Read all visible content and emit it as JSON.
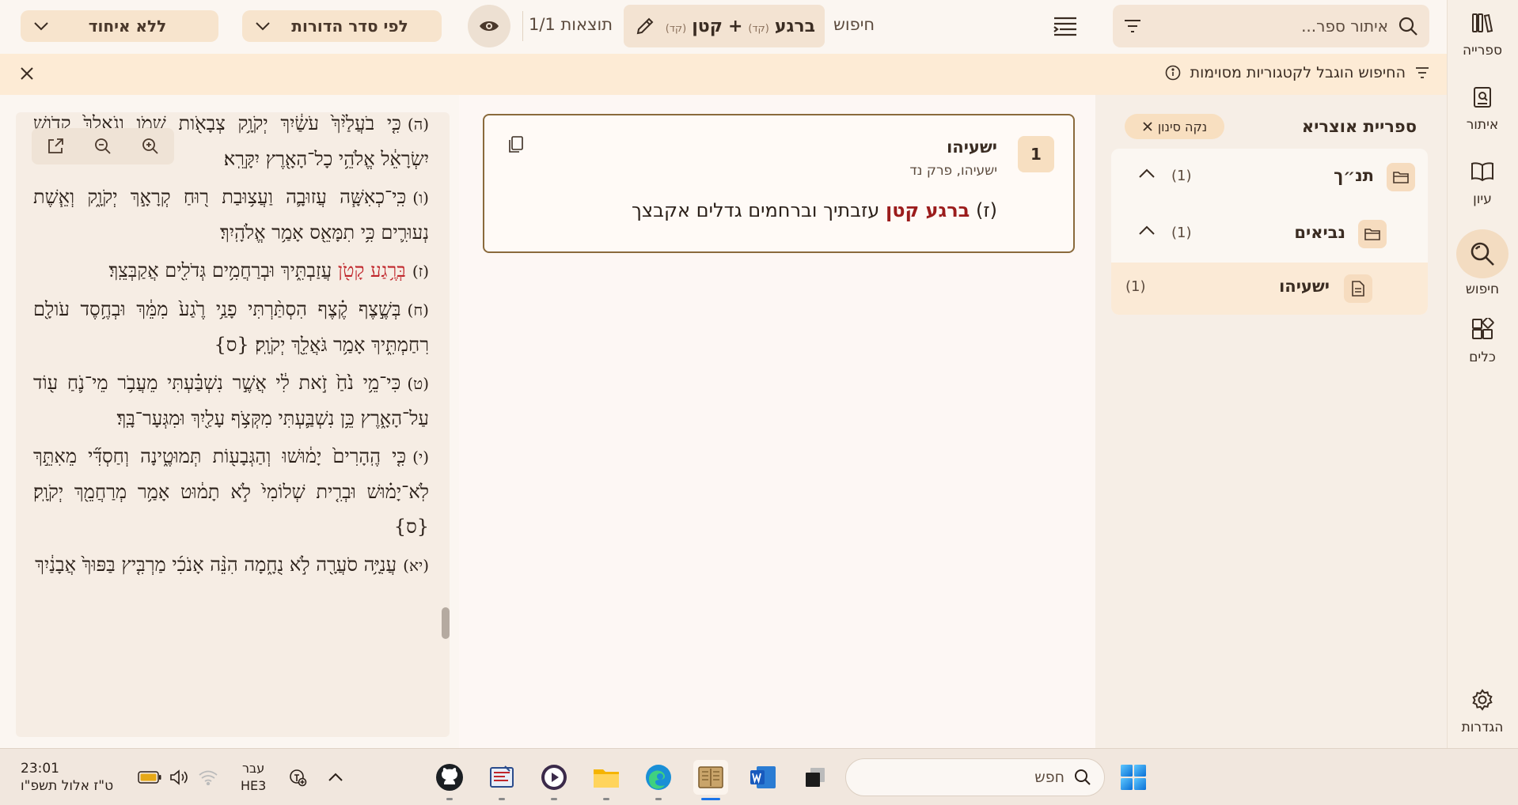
{
  "rail": {
    "items": [
      {
        "label": "ספרייה",
        "icon": "library-icon"
      },
      {
        "label": "איתור",
        "icon": "locate-icon"
      },
      {
        "label": "עיון",
        "icon": "book-open-icon"
      },
      {
        "label": "חיפוש",
        "icon": "search-icon"
      },
      {
        "label": "כלים",
        "icon": "tools-icon"
      },
      {
        "label": "הגדרות",
        "icon": "gear-icon"
      }
    ],
    "active": "חיפוש"
  },
  "topbar": {
    "search_placeholder": "איתור ספר...",
    "tab_label": "חיפוש",
    "query_chip": {
      "term1": "ברגע",
      "term2": "קטן",
      "tag": "(קד)",
      "plus": "+"
    },
    "results_count": "1/1 תוצאות",
    "sort_dropdown": "לפי סדר הדורות",
    "group_dropdown": "ללא איחוד"
  },
  "notice": {
    "text": "החיפוש הוגבל לקטגוריות מסוימות"
  },
  "categories": {
    "title": "ספריית אוצריא",
    "clear_filter": "נקה סינון",
    "tree": [
      {
        "name": "תנ״ך",
        "count": "(1)",
        "type": "folder"
      },
      {
        "name": "נביאים",
        "count": "(1)",
        "type": "folder"
      },
      {
        "name": "ישעיהו",
        "count": "(1)",
        "type": "book"
      }
    ]
  },
  "result": {
    "number": "1",
    "title": "ישעיהו",
    "subtitle": "ישעיהו, פרק נד",
    "prefix": "(ז)",
    "highlight": "ברגע קטן",
    "rest": "עזבתיך וברחמים גדלים אקבצך"
  },
  "preview": {
    "verses": [
      {
        "n": "(ה)",
        "text": "כִּ֤י בֹעֲלַ֙יִךְ֙ עֹשַׂ֔יִךְ יְקֹוָ֥ק צְבָאֹ֖ות שְׁמֹ֑ו וְגֹאֲלֵךְ֙ קְדֹ֣ושׁ יִשְׂרָאֵ֔ל אֱלֹהֵ֥י כָל־הָאָ֖רֶץ יִקָּרֵֽא׃"
      },
      {
        "n": "(ו)",
        "text": "כִּֽי־כְאִשָּׁ֧ה עֲזוּבָ֛ה וַעֲצ֥וּבַת ר֖וּחַ קְרָאָ֣ךְ יְקֹוָ֑ק וְאֵ֧שֶׁת נְעוּרִ֛ים כִּ֥י תִמָּאֵ֖ס אָמַ֥ר אֱלֹהָֽיִךְ׃"
      },
      {
        "n": "(ז)",
        "hl": "בְּרֶ֥גַע קָטֹ֖ן",
        "text": "עֲזַבְתִּ֑יךְ וּבְרַחֲמִ֥ים גְּדֹלִ֖ים אֲקַבְּצֵֽךְ׃"
      },
      {
        "n": "(ח)",
        "text": "בְּשֶׁ֣צֶף קֶ֗צֶף הִסְתַּ֨רְתִּי פָנַ֥י רֶ֙גַע֙ מִמֵּ֔ךְ וּבְחֶ֥סֶד עֹולָ֖ם רִחַמְתִּ֑יךְ אָמַ֥ר גֹּאֲלֵ֖ךְ יְקֹוָֽק׃ {ס}"
      },
      {
        "n": "(ט)",
        "text": "כִּי־מֵ֥י נֹ֙חַ֙ זֹ֣את לִ֔י אֲשֶׁ֣ר נִשְׁבַּ֗עְתִּי מֵעֲבֹ֥ר מֵי־נֹ֛חַ ע֖וֹד עַל־הָאָ֑רֶץ כֵּ֥ן נִשְׁבַּ֛עְתִּי מִקְּצֹ֥ף עָלַ֖יִךְ וּמִגְּעָר־בָּֽךְ׃"
      },
      {
        "n": "(י)",
        "text": "כִּ֤י הֶֽהָרִים֙ יָמ֔וּשׁוּ וְהַגְּבָע֖וֹת תְּמוּטֶ֑ינָה וְחַסְדִּ֞י מֵאִתֵּ֣ךְ לֹֽא־יָמ֗וּשׁ וּבְרִ֤ית שְׁלוֹמִי֙ לֹ֣א תָמ֔וּט אָמַ֥ר מְרַחֲמֵ֖ךְ יְקֹוָֽק׃ {ס}"
      },
      {
        "n": "(יא)",
        "text": "עֲנִיָּ֥ה סֹעֲרָ֖ה לֹ֣א נֻחָ֑מָה הִנֵּ֨ה אָנֹכִ֜י מַרְבִּ֤יץ בַּפּוּךְ֙ אֲבָנַ֔יִךְ"
      }
    ]
  },
  "taskbar": {
    "time": "23:01",
    "date": "ט\"ז אלול תשפ\"ו",
    "lang_top": "עבר",
    "lang_bottom": "HE3",
    "search_placeholder": "חפש",
    "apps": [
      "github",
      "scanner",
      "media-player",
      "file-explorer",
      "edge",
      "otzaria",
      "word",
      "task-view"
    ]
  },
  "colors": {
    "accent": "#f3dcc1",
    "highlight": "#9b1c1c",
    "card_border": "#8a6a3c"
  }
}
